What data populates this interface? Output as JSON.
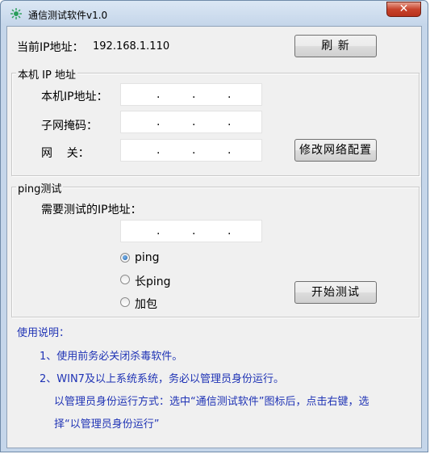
{
  "window": {
    "title": "通信测试软件v1.0",
    "close_glyph": "✕"
  },
  "current_ip": {
    "label": "当前IP地址：",
    "value": "192.168.1.110",
    "refresh_button": "刷  新"
  },
  "local_ip_group": {
    "title": "本机 IP 地址",
    "ip_label": "本机IP地址：",
    "mask_label": "子网掩码：",
    "gateway_label": "网    关：",
    "modify_button": "修改网络配置",
    "dot": "."
  },
  "ping_group": {
    "title": "ping测试",
    "target_label": "需要测试的IP地址：",
    "options": [
      {
        "label": "ping",
        "selected": true
      },
      {
        "label": "长ping",
        "selected": false
      },
      {
        "label": "加包",
        "selected": false
      }
    ],
    "start_button": "开始测试"
  },
  "usage": {
    "heading": "使用说明：",
    "line1": "1、使用前务必关闭杀毒软件。",
    "line2": "2、WIN7及以上系统系统，务必以管理员身份运行。",
    "line3": "以管理员身份运行方式：选中“通信测试软件”图标后，点击右键，选",
    "line4": "择“以管理员身份运行”"
  },
  "colors": {
    "usage_text": "#1f33b5",
    "close_button": "#c7432c"
  }
}
